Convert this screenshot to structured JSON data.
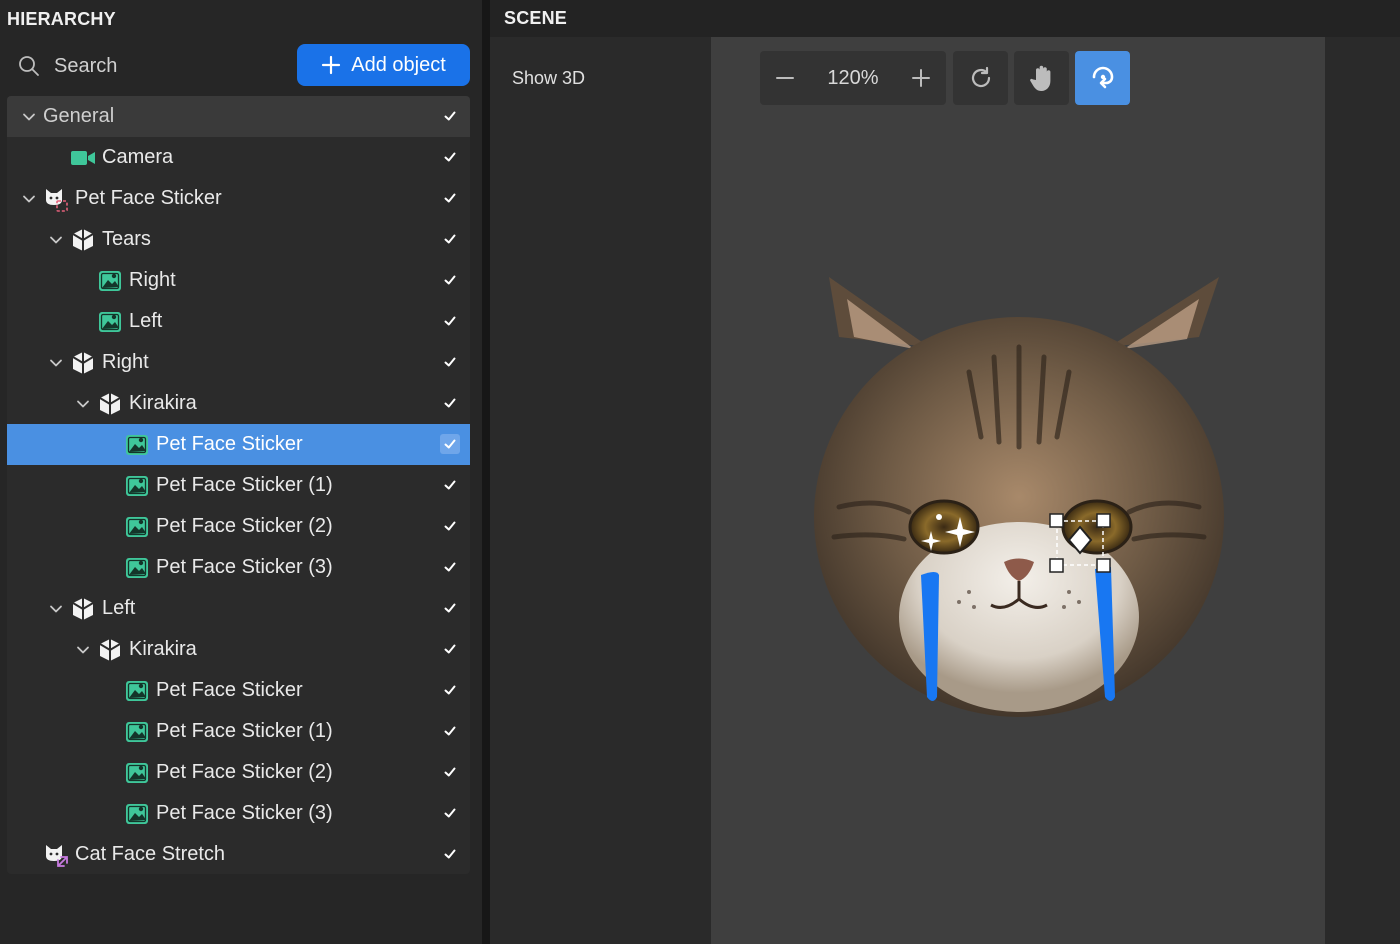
{
  "hierarchy": {
    "title": "HIERARCHY",
    "search_placeholder": "Search",
    "add_object_label": "Add object",
    "rows": [
      {
        "label": "General",
        "depth": 0,
        "chevron": true,
        "icon": "none",
        "general": true
      },
      {
        "label": "Camera",
        "depth": 1,
        "chevron": false,
        "icon": "camera-icon"
      },
      {
        "label": "Pet Face Sticker",
        "depth": 0,
        "chevron": true,
        "icon": "pet-face-icon"
      },
      {
        "label": "Tears",
        "depth": 1,
        "chevron": true,
        "icon": "group-icon"
      },
      {
        "label": "Right",
        "depth": 2,
        "chevron": false,
        "icon": "image-icon"
      },
      {
        "label": "Left",
        "depth": 2,
        "chevron": false,
        "icon": "image-icon"
      },
      {
        "label": "Right",
        "depth": 1,
        "chevron": true,
        "icon": "group-icon"
      },
      {
        "label": "Kirakira",
        "depth": 2,
        "chevron": true,
        "icon": "group-icon"
      },
      {
        "label": "Pet Face Sticker",
        "depth": 3,
        "chevron": false,
        "icon": "image-icon",
        "selected": true
      },
      {
        "label": "Pet Face Sticker (1)",
        "depth": 3,
        "chevron": false,
        "icon": "image-icon"
      },
      {
        "label": "Pet Face Sticker (2)",
        "depth": 3,
        "chevron": false,
        "icon": "image-icon"
      },
      {
        "label": "Pet Face Sticker (3)",
        "depth": 3,
        "chevron": false,
        "icon": "image-icon"
      },
      {
        "label": "Left",
        "depth": 1,
        "chevron": true,
        "icon": "group-icon"
      },
      {
        "label": "Kirakira",
        "depth": 2,
        "chevron": true,
        "icon": "group-icon"
      },
      {
        "label": "Pet Face Sticker",
        "depth": 3,
        "chevron": false,
        "icon": "image-icon"
      },
      {
        "label": "Pet Face Sticker (1)",
        "depth": 3,
        "chevron": false,
        "icon": "image-icon"
      },
      {
        "label": "Pet Face Sticker (2)",
        "depth": 3,
        "chevron": false,
        "icon": "image-icon"
      },
      {
        "label": "Pet Face Sticker (3)",
        "depth": 3,
        "chevron": false,
        "icon": "image-icon"
      },
      {
        "label": "Cat Face Stretch",
        "depth": 0,
        "chevron": false,
        "icon": "cat-stretch-icon"
      }
    ]
  },
  "scene": {
    "title": "SCENE",
    "show3d_label": "Show 3D",
    "zoom_level": "120%"
  },
  "colors": {
    "accent": "#1a72e8",
    "selected_row": "#4a90e2",
    "icon_green": "#3fc79a",
    "tear_blue": "#1877f2"
  }
}
